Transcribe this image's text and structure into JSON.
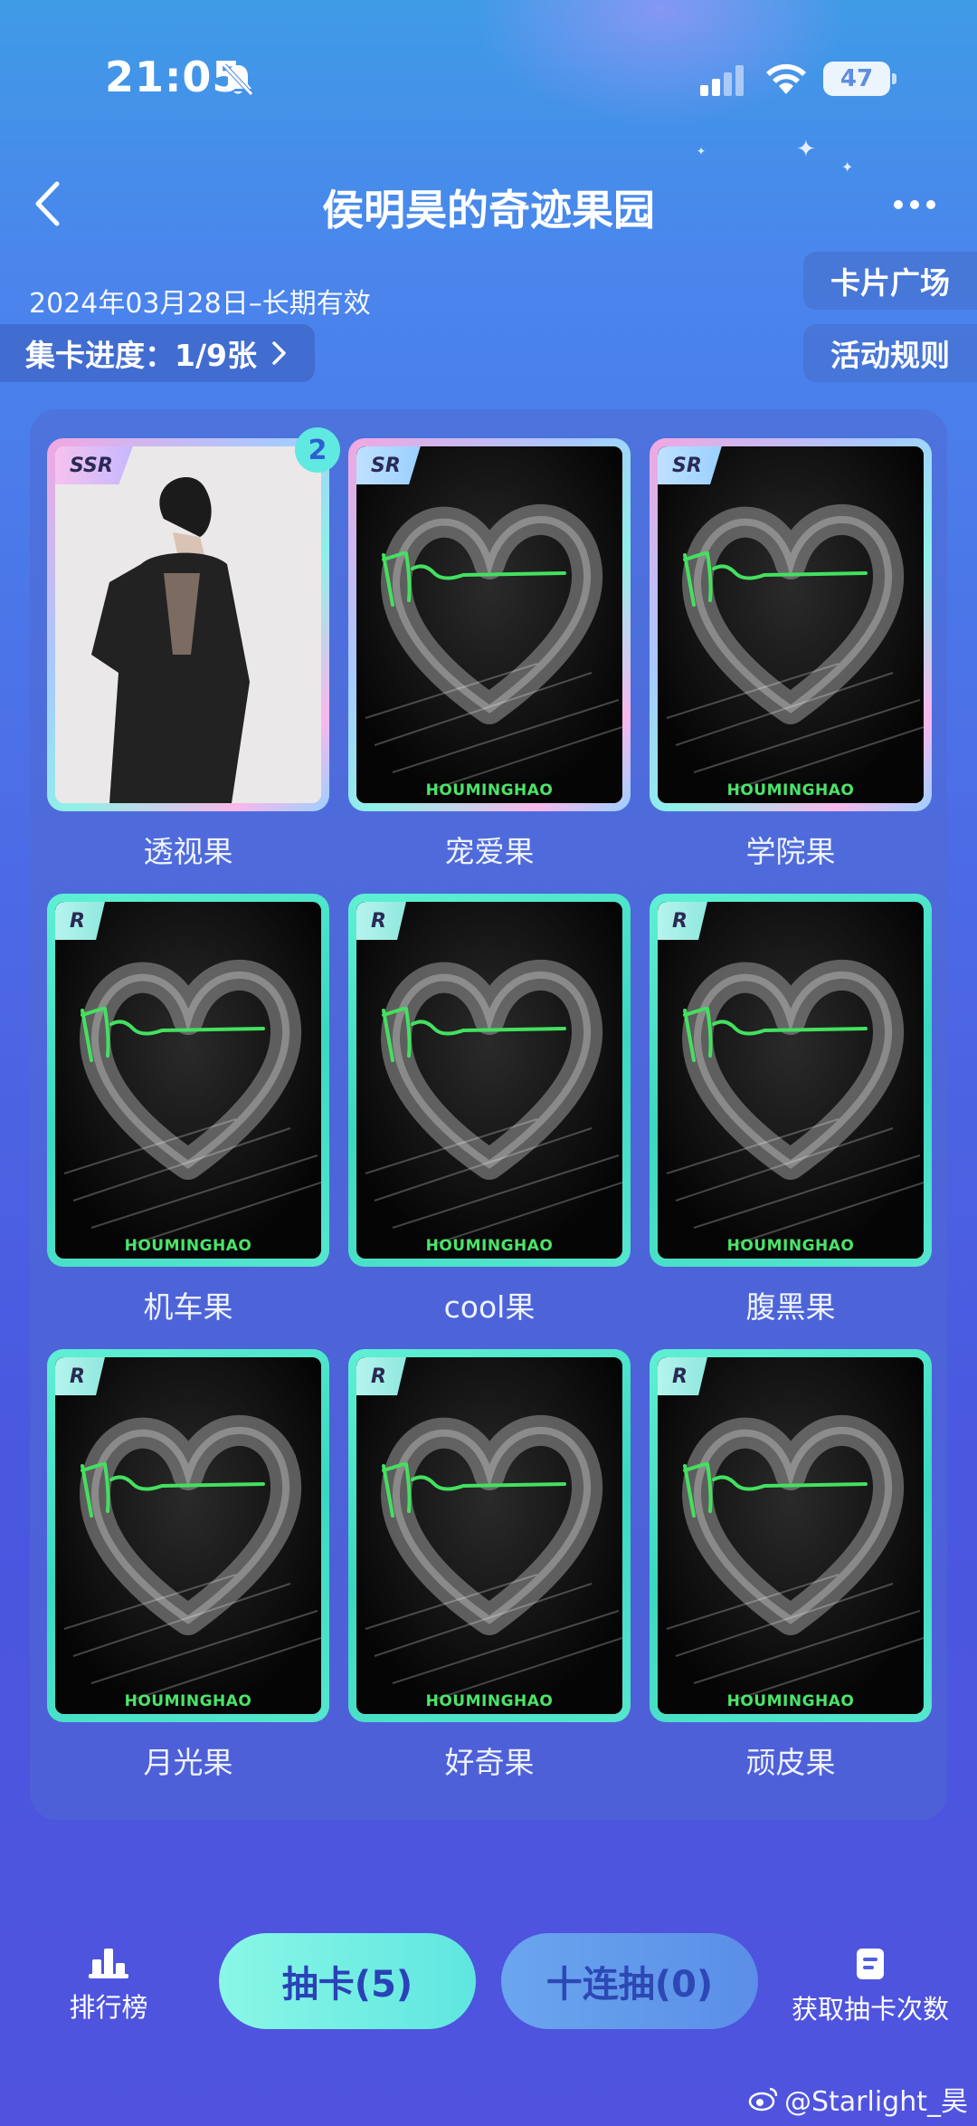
{
  "status_bar": {
    "time": "21:05",
    "battery": "47"
  },
  "header": {
    "title": "侯明昊的奇迹果园"
  },
  "info": {
    "date_range": "2024年03月28日–长期有效",
    "progress_label": "集卡进度：1/9张",
    "card_square": "卡片广场",
    "rules": "活动规则"
  },
  "cards": [
    {
      "name": "透视果",
      "rarity": "SSR",
      "count": "2",
      "brand": ""
    },
    {
      "name": "宠爱果",
      "rarity": "SR",
      "count": "",
      "brand": "HOUMINGHAO"
    },
    {
      "name": "学院果",
      "rarity": "SR",
      "count": "",
      "brand": "HOUMINGHAO"
    },
    {
      "name": "机车果",
      "rarity": "R",
      "count": "",
      "brand": "HOUMINGHAO"
    },
    {
      "name": "cool果",
      "rarity": "R",
      "count": "",
      "brand": "HOUMINGHAO"
    },
    {
      "name": "腹黑果",
      "rarity": "R",
      "count": "",
      "brand": "HOUMINGHAO"
    },
    {
      "name": "月光果",
      "rarity": "R",
      "count": "",
      "brand": "HOUMINGHAO"
    },
    {
      "name": "好奇果",
      "rarity": "R",
      "count": "",
      "brand": "HOUMINGHAO"
    },
    {
      "name": "顽皮果",
      "rarity": "R",
      "count": "",
      "brand": "HOUMINGHAO"
    }
  ],
  "bottom_bar": {
    "rank": "排行榜",
    "draw": "抽卡(5)",
    "ten_draw": "十连抽(0)",
    "earn": "获取抽卡次数"
  },
  "watermark": "@Starlight_昊",
  "icons": [
    "bell-muted-icon",
    "signal-icon",
    "wifi-icon",
    "back-icon",
    "more-icon",
    "chevron-right-icon",
    "bar-chart-icon",
    "document-icon",
    "weibo-icon"
  ],
  "colors": {
    "accent_cyan": "#5fe9e1",
    "signature_green": "#4be46a",
    "button_text": "#2a42b8"
  }
}
